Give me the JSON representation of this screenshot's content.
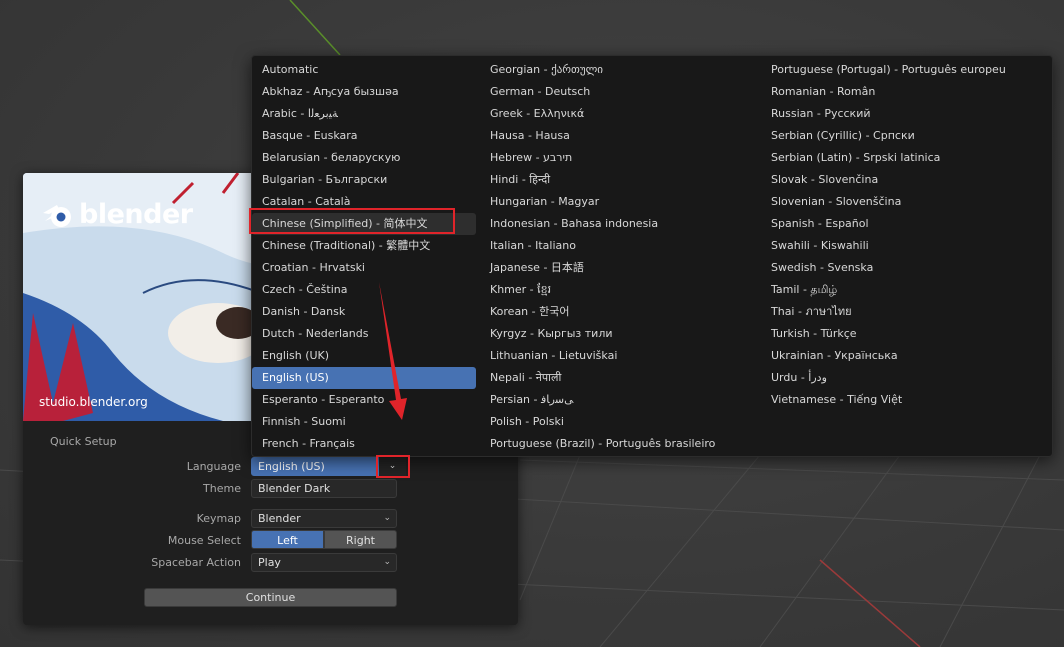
{
  "colors": {
    "accent": "#4772b3",
    "highlight_box": "#e0242a",
    "menu_bg": "#181818",
    "panel_bg": "#1f1f1f"
  },
  "splash": {
    "logo_text": "blender",
    "site_url": "studio.blender.org",
    "quick_setup_title": "Quick Setup",
    "language_label": "Language",
    "language_value": "English (US)",
    "theme_label": "Theme",
    "theme_value": "Blender Dark",
    "keymap_label": "Keymap",
    "keymap_value": "Blender",
    "mouse_select_label": "Mouse Select",
    "mouse_left": "Left",
    "mouse_right": "Right",
    "spacebar_label": "Spacebar Action",
    "spacebar_value": "Play",
    "continue_label": "Continue"
  },
  "language_menu": {
    "columns": [
      [
        "Automatic",
        "Abkhaz - Аҧсуа бызшәа",
        "Arabic - ﺔﻴﺑﺮﻌﻟﺍ",
        "Basque - Euskara",
        "Belarusian - беларускую",
        "Bulgarian - Български",
        "Catalan - Català",
        "Chinese (Simplified) - 简体中文",
        "Chinese (Traditional) - 繁體中文",
        "Croatian - Hrvatski",
        "Czech - Čeština",
        "Danish - Dansk",
        "Dutch - Nederlands",
        "English (UK)",
        "English (US)",
        "Esperanto - Esperanto",
        "Finnish - Suomi",
        "French - Français"
      ],
      [
        "Georgian - ქართული",
        "German - Deutsch",
        "Greek - Ελληνικά",
        "Hausa - Hausa",
        "Hebrew - תירבע",
        "Hindi - हिन्दी",
        "Hungarian - Magyar",
        "Indonesian - Bahasa indonesia",
        "Italian - Italiano",
        "Japanese - 日本語",
        "Khmer - ខ្មែរ",
        "Korean - 한국어",
        "Kyrgyz - Кыргыз тили",
        "Lithuanian - Lietuviškai",
        "Nepali - नेपाली",
        "Persian - ﯽﺳﺭﺎﻓ",
        "Polish - Polski",
        "Portuguese (Brazil) - Português brasileiro"
      ],
      [
        "Portuguese (Portugal) - Português europeu",
        "Romanian - Român",
        "Russian - Русский",
        "Serbian (Cyrillic) - Српски",
        "Serbian (Latin) - Srpski latinica",
        "Slovak - Slovenčina",
        "Slovenian - Slovenščina",
        "Spanish - Español",
        "Swahili - Kiswahili",
        "Swedish - Svenska",
        "Tamil - தமிழ்",
        "Thai - ภาษาไทย",
        "Turkish - Türkçe",
        "Ukrainian - Українська",
        "Urdu - ﻭﺩﺭﺃ",
        "Vietnamese - Tiếng Việt"
      ]
    ],
    "selected": "English (US)",
    "hovered": "Chinese (Simplified) - 简体中文"
  },
  "icons": {
    "logo": "blender-logo-icon",
    "dropdown": "chevron-down-icon",
    "annotation": "red-arrow-annotation"
  }
}
